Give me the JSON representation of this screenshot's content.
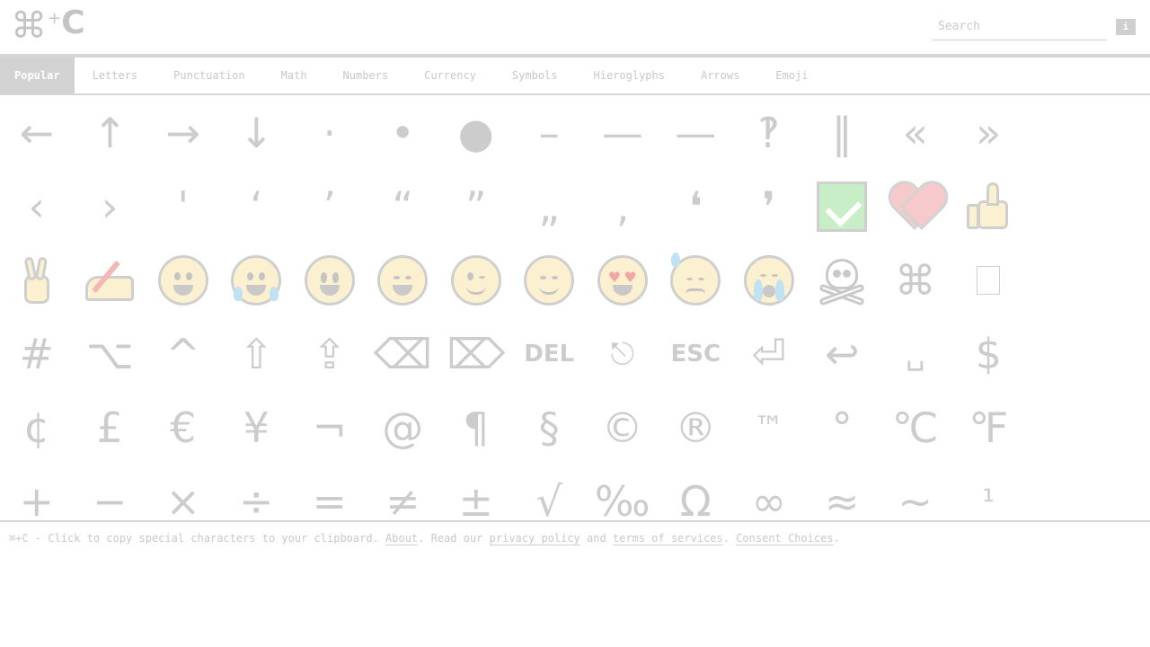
{
  "header": {
    "logo_cmd": "⌘",
    "logo_plus": "+",
    "logo_c": "C",
    "search_placeholder": "Search",
    "info_label": "i"
  },
  "tabs": [
    {
      "label": "Popular",
      "active": true
    },
    {
      "label": "Letters"
    },
    {
      "label": "Punctuation"
    },
    {
      "label": "Math"
    },
    {
      "label": "Numbers"
    },
    {
      "label": "Currency"
    },
    {
      "label": "Symbols"
    },
    {
      "label": "Hieroglyphs"
    },
    {
      "label": "Arrows"
    },
    {
      "label": "Emoji"
    }
  ],
  "rows": [
    [
      "←",
      "↑",
      "→",
      "↓",
      "·",
      "•",
      "●",
      "–",
      "—",
      "—",
      "‽",
      "‖",
      "«",
      "»"
    ],
    [
      "‹",
      "›",
      "'",
      "‘",
      "’",
      "“",
      "”",
      "„",
      "‚",
      "❛",
      "❜",
      "",
      "",
      ""
    ],
    [
      "",
      "",
      "",
      "",
      "",
      "",
      "",
      "",
      "",
      "",
      "",
      "",
      "⌘",
      ""
    ],
    [
      "#",
      "⌥",
      "^",
      "⇧",
      "⇪",
      "⌫",
      "⌦",
      "DEL",
      "⎋",
      "ESC",
      "⏎",
      "↩",
      "␣",
      "$"
    ],
    [
      "¢",
      "£",
      "€",
      "¥",
      "¬",
      "@",
      "¶",
      "§",
      "©",
      "®",
      "™",
      "°",
      "℃",
      "℉"
    ],
    [
      "+",
      "−",
      "×",
      "÷",
      "=",
      "≠",
      "±",
      "√",
      "‰",
      "Ω",
      "∞",
      "≈",
      "~",
      "¹"
    ]
  ],
  "emoji_names": {
    "row2_11": "check-mark-button",
    "row2_12": "red-heart",
    "row2_13": "thumbs-up",
    "row3_0": "victory-hand",
    "row3_1": "writing-hand",
    "row3_2": "grinning-face",
    "row3_3": "face-with-tears-of-joy",
    "row3_4": "grinning-face-big-eyes",
    "row3_5": "grinning-face-smiling-eyes",
    "row3_6": "winking-face",
    "row3_7": "smiling-face",
    "row3_8": "heart-eyes-face",
    "row3_9": "downcast-face-sweat",
    "row3_10": "loudly-crying-face",
    "row3_11": "skull-crossbones",
    "row3_13": "empty-box"
  },
  "footer": {
    "prefix": "⌘+C - Click to copy special characters to your clipboard. ",
    "about": "About",
    "mid1": ". Read our ",
    "privacy": "privacy policy",
    "mid2": " and ",
    "terms": "terms of services",
    "mid3": ". ",
    "consent": "Consent Choices",
    "end": "."
  }
}
